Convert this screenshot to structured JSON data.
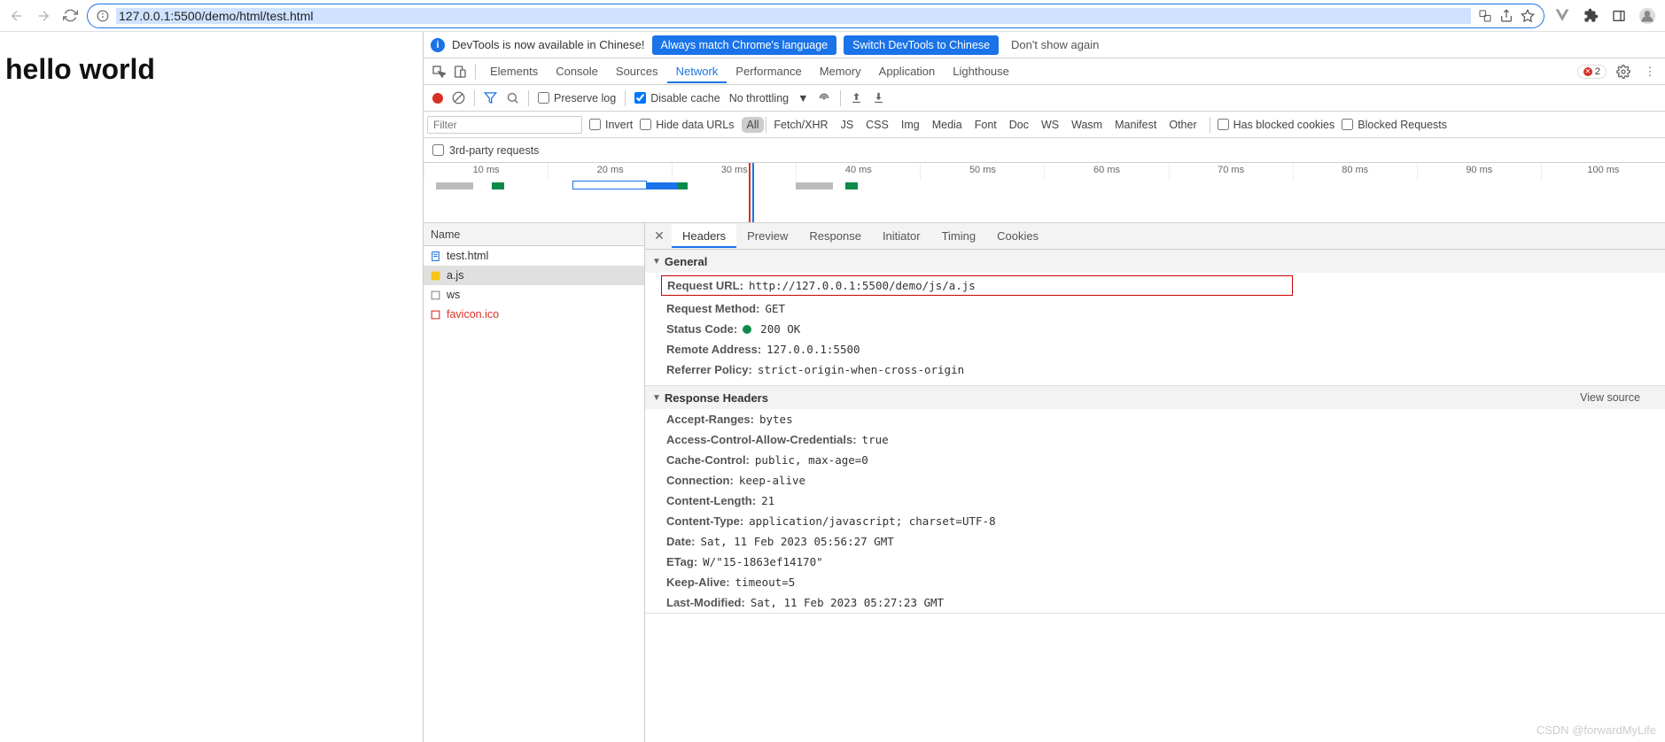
{
  "url": "127.0.0.1:5500/demo/html/test.html",
  "page_heading": "hello world",
  "infobar": {
    "text": "DevTools is now available in Chinese!",
    "btn1": "Always match Chrome's language",
    "btn2": "Switch DevTools to Chinese",
    "btn3": "Don't show again"
  },
  "tabs": [
    "Elements",
    "Console",
    "Sources",
    "Network",
    "Performance",
    "Memory",
    "Application",
    "Lighthouse"
  ],
  "active_tab": "Network",
  "error_count": "2",
  "toolbar": {
    "preserve_log": "Preserve log",
    "disable_cache": "Disable cache",
    "throttling": "No throttling"
  },
  "filter": {
    "placeholder": "Filter",
    "invert": "Invert",
    "hide_urls": "Hide data URLs",
    "types": [
      "All",
      "Fetch/XHR",
      "JS",
      "CSS",
      "Img",
      "Media",
      "Font",
      "Doc",
      "WS",
      "Wasm",
      "Manifest",
      "Other"
    ],
    "blocked_cookies": "Has blocked cookies",
    "blocked_requests": "Blocked Requests"
  },
  "third_party": "3rd-party requests",
  "timeline_ticks": [
    "10 ms",
    "20 ms",
    "30 ms",
    "40 ms",
    "50 ms",
    "60 ms",
    "70 ms",
    "80 ms",
    "90 ms",
    "100 ms"
  ],
  "req_header": "Name",
  "requests": [
    {
      "name": "test.html",
      "icon": "doc",
      "color": ""
    },
    {
      "name": "a.js",
      "icon": "js",
      "color": ""
    },
    {
      "name": "ws",
      "icon": "ws",
      "color": ""
    },
    {
      "name": "favicon.ico",
      "icon": "img",
      "color": "red"
    }
  ],
  "detail_tabs": [
    "Headers",
    "Preview",
    "Response",
    "Initiator",
    "Timing",
    "Cookies"
  ],
  "active_detail_tab": "Headers",
  "general": {
    "title": "General",
    "url_k": "Request URL:",
    "url_v": "http://127.0.0.1:5500/demo/js/a.js",
    "method_k": "Request Method:",
    "method_v": "GET",
    "status_k": "Status Code:",
    "status_v": "200 OK",
    "remote_k": "Remote Address:",
    "remote_v": "127.0.0.1:5500",
    "ref_k": "Referrer Policy:",
    "ref_v": "strict-origin-when-cross-origin"
  },
  "resp_headers": {
    "title": "Response Headers",
    "view_source": "View source",
    "items": [
      {
        "k": "Accept-Ranges:",
        "v": "bytes"
      },
      {
        "k": "Access-Control-Allow-Credentials:",
        "v": "true"
      },
      {
        "k": "Cache-Control:",
        "v": "public, max-age=0"
      },
      {
        "k": "Connection:",
        "v": "keep-alive"
      },
      {
        "k": "Content-Length:",
        "v": "21"
      },
      {
        "k": "Content-Type:",
        "v": "application/javascript; charset=UTF-8"
      },
      {
        "k": "Date:",
        "v": "Sat, 11 Feb 2023 05:56:27 GMT"
      },
      {
        "k": "ETag:",
        "v": "W/\"15-1863ef14170\""
      },
      {
        "k": "Keep-Alive:",
        "v": "timeout=5"
      },
      {
        "k": "Last-Modified:",
        "v": "Sat, 11 Feb 2023 05:27:23 GMT"
      }
    ]
  },
  "watermark": "CSDN @forwardMyLife"
}
